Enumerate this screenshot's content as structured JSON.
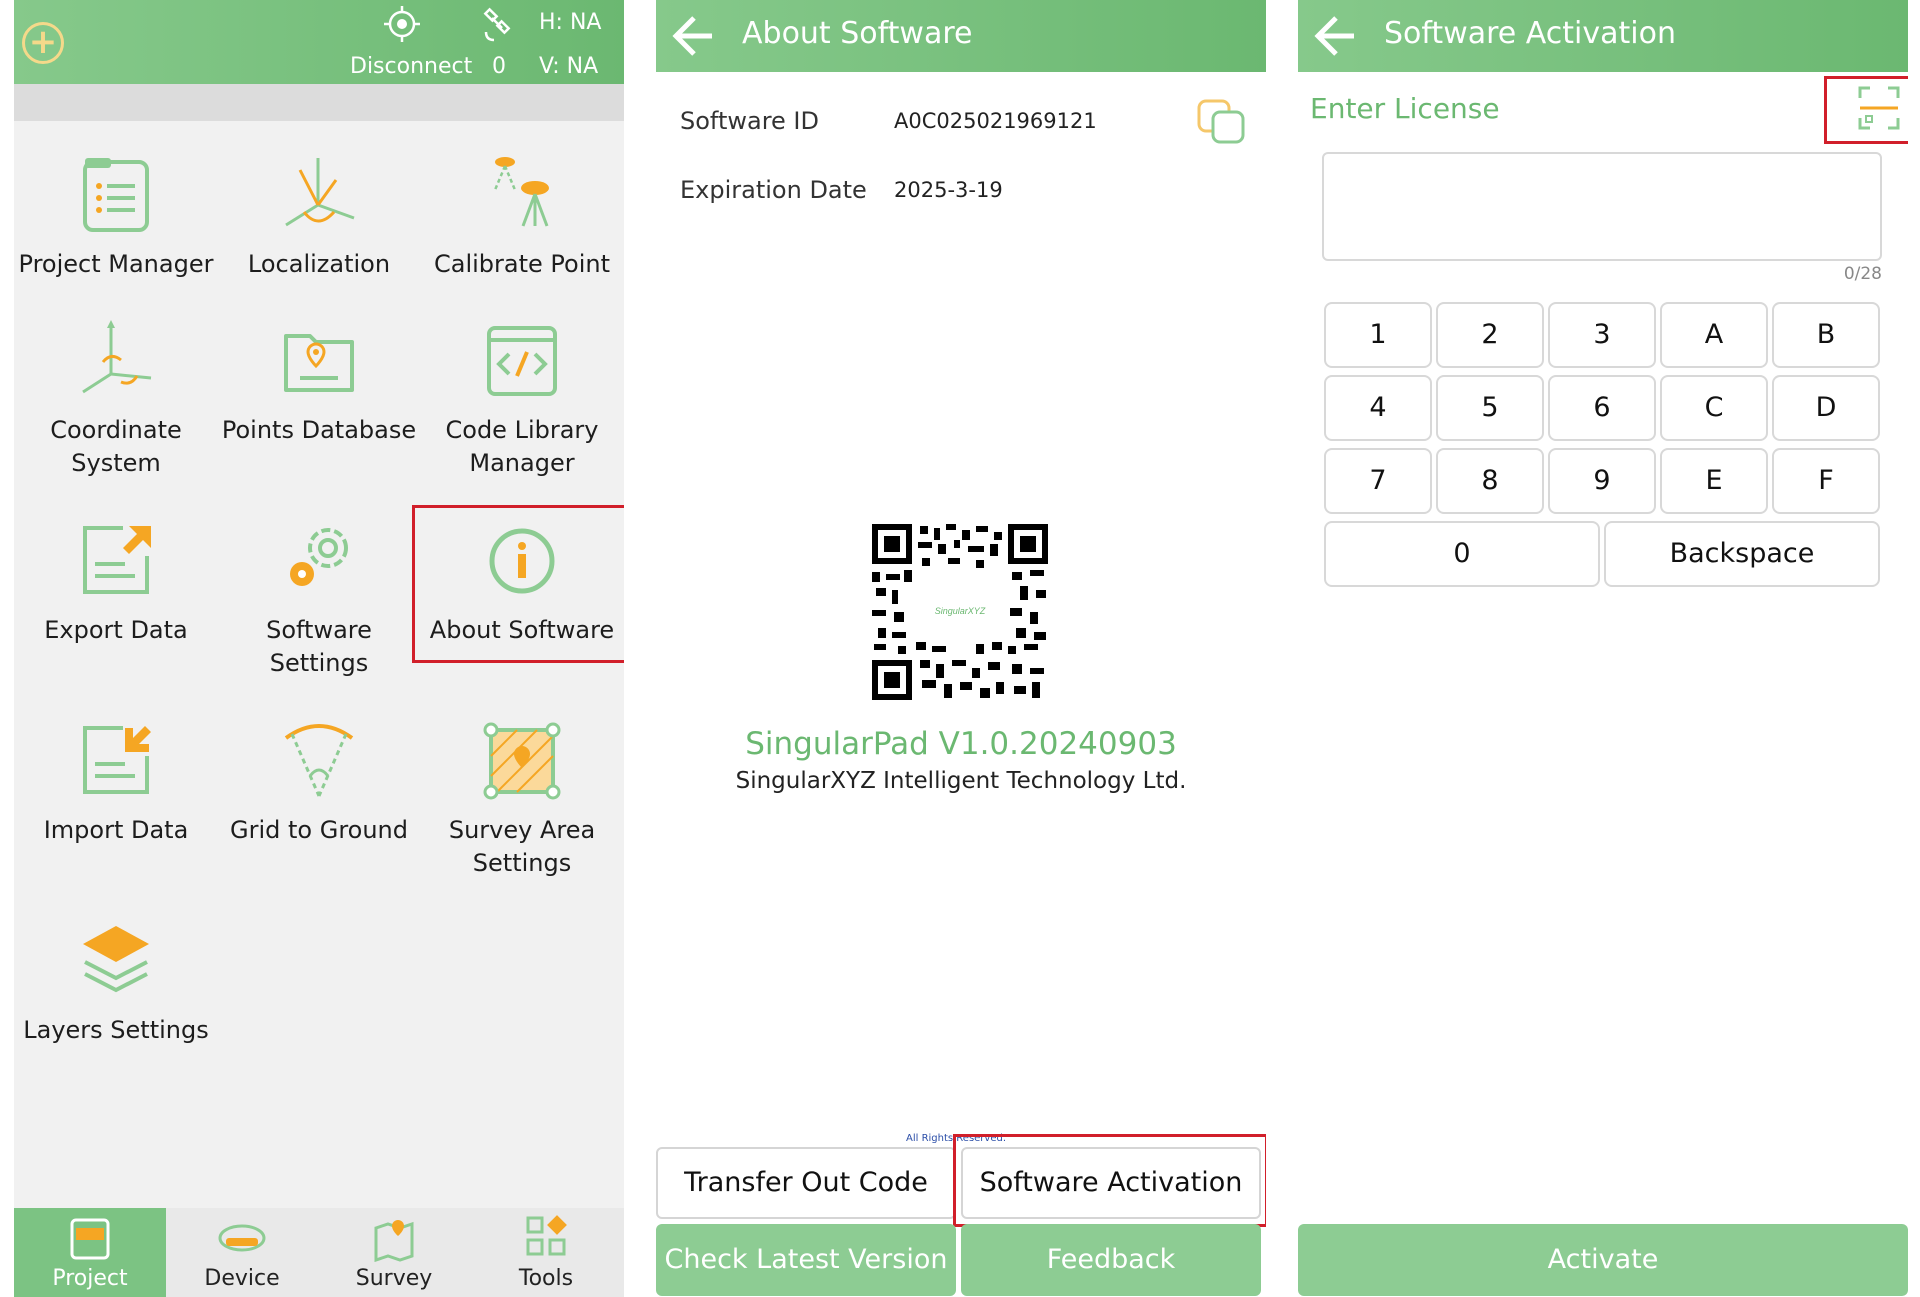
{
  "panel1": {
    "topbar": {
      "status_text": "Disconnect",
      "satellite_count": "0",
      "h_value": "H: NA",
      "v_value": "V: NA"
    },
    "grid": [
      {
        "label": "Project Manager",
        "icon": "project-manager-icon"
      },
      {
        "label": "Localization",
        "icon": "localization-icon"
      },
      {
        "label": "Calibrate Point",
        "icon": "calibrate-point-icon"
      },
      {
        "label": "Coordinate System",
        "icon": "coordinate-system-icon"
      },
      {
        "label": "Points Database",
        "icon": "points-database-icon"
      },
      {
        "label": "Code Library Manager",
        "icon": "code-library-icon"
      },
      {
        "label": "Export Data",
        "icon": "export-data-icon"
      },
      {
        "label": "Software Settings",
        "icon": "software-settings-icon"
      },
      {
        "label": "About Software",
        "icon": "about-software-icon"
      },
      {
        "label": "Import Data",
        "icon": "import-data-icon"
      },
      {
        "label": "Grid to Ground",
        "icon": "grid-to-ground-icon"
      },
      {
        "label": "Survey Area Settings",
        "icon": "survey-area-icon"
      },
      {
        "label": "Layers Settings",
        "icon": "layers-icon"
      }
    ],
    "nav": [
      {
        "label": "Project",
        "active": true
      },
      {
        "label": "Device",
        "active": false
      },
      {
        "label": "Survey",
        "active": false
      },
      {
        "label": "Tools",
        "active": false
      }
    ]
  },
  "panel2": {
    "title": "About Software",
    "software_id_label": "Software ID",
    "software_id_value": "A0C025021969121",
    "expiration_label": "Expiration Date",
    "expiration_value": "2025-3-19",
    "qr_brand": "SingularXYZ",
    "version": "SingularPad V1.0.20240903",
    "company": "SingularXYZ Intelligent Technology Ltd.",
    "rights": "All Rights Reserved.",
    "buttons": {
      "transfer_out": "Transfer Out Code",
      "activation": "Software Activation",
      "check_version": "Check Latest Version",
      "feedback": "Feedback"
    }
  },
  "panel3": {
    "title": "Software Activation",
    "license_label": "Enter License",
    "license_value": "",
    "counter": "0/28",
    "keys_row1": [
      "1",
      "2",
      "3",
      "A",
      "B"
    ],
    "keys_row2": [
      "4",
      "5",
      "6",
      "C",
      "D"
    ],
    "keys_row3": [
      "7",
      "8",
      "9",
      "E",
      "F"
    ],
    "key_zero": "0",
    "key_backspace": "Backspace",
    "activate": "Activate"
  },
  "colors": {
    "green": "#6bb871",
    "light_green": "#8dcc93",
    "accent_orange": "#f5a623",
    "highlight_red": "#d11f2a"
  }
}
